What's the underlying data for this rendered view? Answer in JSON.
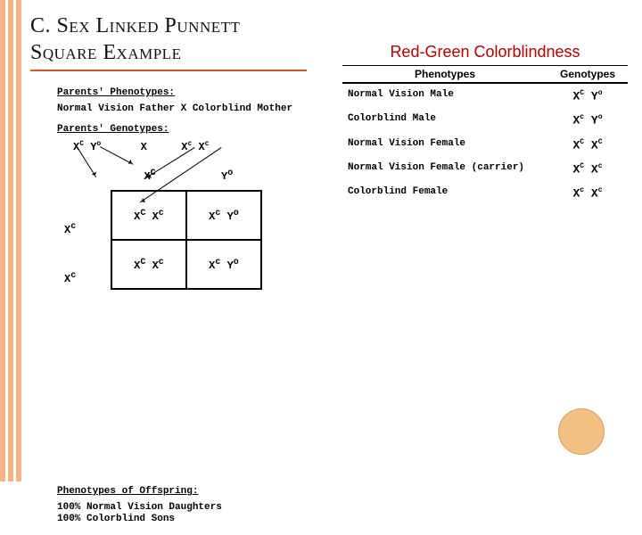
{
  "title": "C. Sex Linked Punnett Square Example",
  "left": {
    "p_pheno_hdr": "Parents' Phenotypes:",
    "p_pheno_txt": "Normal Vision Father  X  Colorblind Mother",
    "p_geno_hdr": "Parents' Genotypes:",
    "father_g": "X<sup>C</sup> Y<sup>o</sup>",
    "cross_x": "X",
    "mother_g": "X<sup>c</sup> X<sup>c</sup>",
    "col1": "X<sup>C</sup>",
    "col2": "Y<sup>o</sup>",
    "row1": "X<sup>c</sup>",
    "row2": "X<sup>c</sup>",
    "cell11": "X<sup>C</sup> X<sup>c</sup>",
    "cell12": "X<sup>c</sup> Y<sup>o</sup>",
    "cell21": "X<sup>C</sup> X<sup>c</sup>",
    "cell22": "X<sup>c</sup> Y<sup>o</sup>",
    "off_hdr": "Phenotypes of Offspring:",
    "off1": "100% Normal Vision Daughters",
    "off2": "100% Colorblind Sons"
  },
  "right": {
    "title": "Red-Green Colorblindness",
    "head_pheno": "Phenotypes",
    "head_geno": "Genotypes",
    "rows": [
      {
        "pheno": "Normal Vision Male",
        "geno": "X<sup>C</sup> Y<sup>o</sup>"
      },
      {
        "pheno": "Colorblind Male",
        "geno": "X<sup>c</sup> Y<sup>o</sup>"
      },
      {
        "pheno": "Normal Vision Female",
        "geno": "X<sup>C</sup> X<sup>C</sup>"
      },
      {
        "pheno": "Normal Vision Female (carrier)",
        "geno": "X<sup>C</sup> X<sup>c</sup>"
      },
      {
        "pheno": "Colorblind Female",
        "geno": "X<sup>c</sup> X<sup>c</sup>"
      }
    ]
  }
}
